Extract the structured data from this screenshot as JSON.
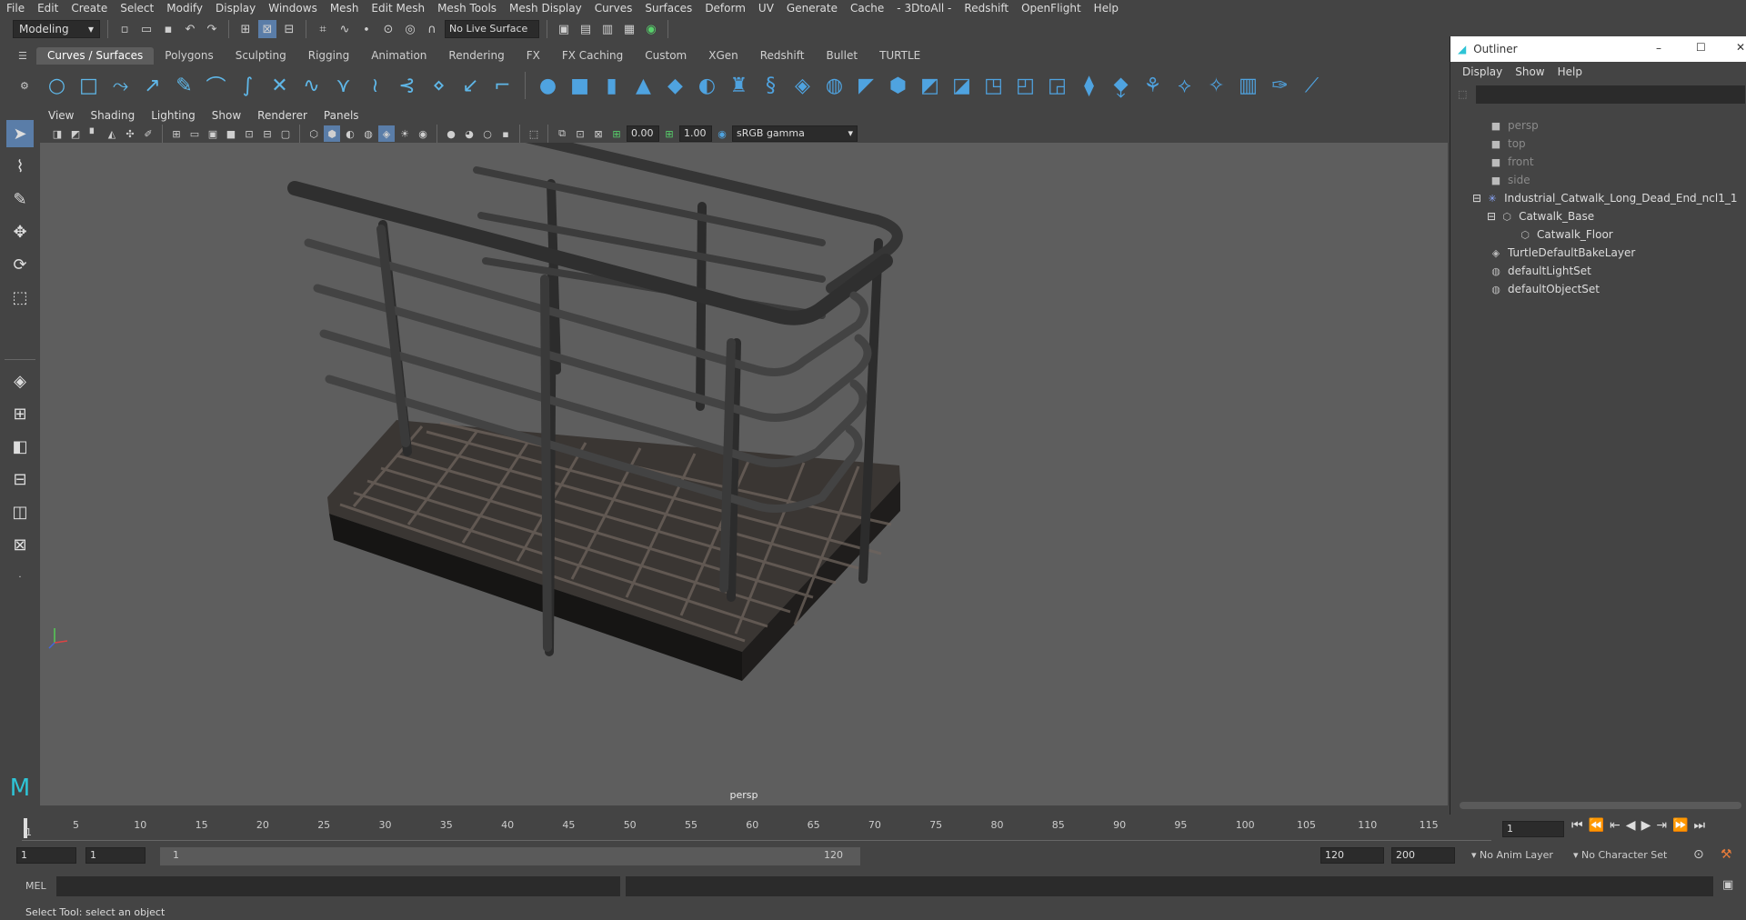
{
  "menubar": [
    "File",
    "Edit",
    "Create",
    "Select",
    "Modify",
    "Display",
    "Windows",
    "Mesh",
    "Edit Mesh",
    "Mesh Tools",
    "Mesh Display",
    "Curves",
    "Surfaces",
    "Deform",
    "UV",
    "Generate",
    "Cache",
    "- 3DtoAll -",
    "Redshift",
    "OpenFlight",
    "Help"
  ],
  "statusline": {
    "mode": "Modeling",
    "live_surface": "No Live Surface"
  },
  "shelf_tabs": [
    {
      "label": "Curves / Surfaces",
      "active": true
    },
    {
      "label": "Polygons"
    },
    {
      "label": "Sculpting"
    },
    {
      "label": "Rigging"
    },
    {
      "label": "Animation"
    },
    {
      "label": "Rendering"
    },
    {
      "label": "FX"
    },
    {
      "label": "FX Caching"
    },
    {
      "label": "Custom"
    },
    {
      "label": "XGen"
    },
    {
      "label": "Redshift"
    },
    {
      "label": "Bullet"
    },
    {
      "label": "TURTLE"
    }
  ],
  "panel_menu": [
    "View",
    "Shading",
    "Lighting",
    "Show",
    "Renderer",
    "Panels"
  ],
  "panel_tools": {
    "exposure": "0.00",
    "gamma": "1.00",
    "color_space": "sRGB gamma"
  },
  "viewport": {
    "camera": "persp"
  },
  "outliner": {
    "title": "Outliner",
    "menu": [
      "Display",
      "Show",
      "Help"
    ],
    "items": [
      {
        "label": "persp",
        "dim": true,
        "icon": "camera-icon"
      },
      {
        "label": "top",
        "dim": true,
        "icon": "camera-icon"
      },
      {
        "label": "front",
        "dim": true,
        "icon": "camera-icon"
      },
      {
        "label": "side",
        "dim": true,
        "icon": "camera-icon"
      },
      {
        "label": "Industrial_Catwalk_Long_Dead_End_ncl1_1",
        "icon": "group-icon"
      },
      {
        "label": "Catwalk_Base",
        "icon": "transform-icon"
      },
      {
        "label": "Catwalk_Floor",
        "icon": "transform-icon"
      },
      {
        "label": "TurtleDefaultBakeLayer",
        "icon": "node-icon"
      },
      {
        "label": "defaultLightSet",
        "icon": "set-icon"
      },
      {
        "label": "defaultObjectSet",
        "icon": "set-icon"
      }
    ]
  },
  "timeline": {
    "ticks": [
      "5",
      "10",
      "15",
      "20",
      "25",
      "30",
      "35",
      "40",
      "45",
      "50",
      "55",
      "60",
      "65",
      "70",
      "75",
      "80",
      "85",
      "90",
      "95",
      "100",
      "105",
      "110",
      "115"
    ],
    "start_label": "1",
    "current_frame": "1"
  },
  "range": {
    "start": "1",
    "playback_start": "1",
    "range_start": "1",
    "range_end": "120",
    "playback_end": "120",
    "end": "200",
    "anim_layer": "No Anim Layer",
    "character_set": "No Character Set"
  },
  "cmdline": {
    "label": "MEL"
  },
  "helpline": {
    "text": "Select Tool: select an object"
  }
}
